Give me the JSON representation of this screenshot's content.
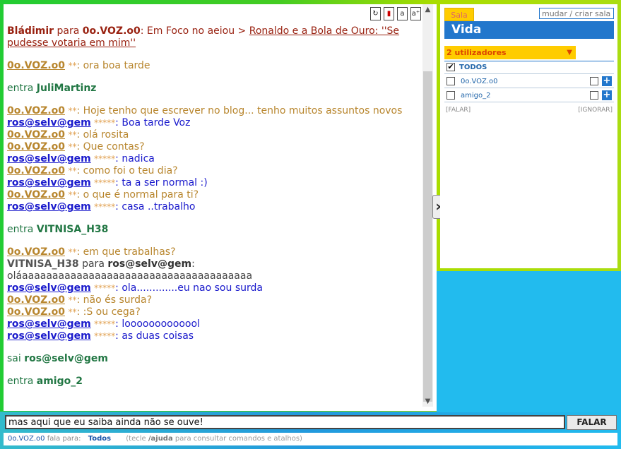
{
  "chat": {
    "messages": [
      {
        "kind": "blad",
        "user": "Blád​imir",
        "para": "para",
        "to": "0o.VOZ.o0",
        "text": ": Em Foco no aeiou > ",
        "link": "Ronaldo e a Bola de Ouro: ''Se pudesse votaria em mim''"
      },
      {
        "kind": "gap"
      },
      {
        "kind": "voz",
        "user": "0o.VOZ.o0",
        "stars": "**",
        "text": ": ora boa tarde"
      },
      {
        "kind": "gap"
      },
      {
        "kind": "entra",
        "action": "entra",
        "user": "JuliMartinz"
      },
      {
        "kind": "gap"
      },
      {
        "kind": "voz",
        "user": "0o.VOZ.o0",
        "stars": "**",
        "text": ": Hoje tenho que escrever no blog... tenho muitos assuntos novos"
      },
      {
        "kind": "ros",
        "user": "ros@selv@gem",
        "stars": "*****",
        "text": ": Boa tarde Voz"
      },
      {
        "kind": "voz",
        "user": "0o.VOZ.o0",
        "stars": "**",
        "text": ": olá rosita"
      },
      {
        "kind": "voz",
        "user": "0o.VOZ.o0",
        "stars": "**",
        "text": ": Que contas?"
      },
      {
        "kind": "ros",
        "user": "ros@selv@gem",
        "stars": "*****",
        "text": ": nadica"
      },
      {
        "kind": "voz",
        "user": "0o.VOZ.o0",
        "stars": "**",
        "text": ": como foi o teu dia?"
      },
      {
        "kind": "ros",
        "user": "ros@selv@gem",
        "stars": "*****",
        "text": ": ta a ser normal :)"
      },
      {
        "kind": "voz",
        "user": "0o.VOZ.o0",
        "stars": "**",
        "text": ": o que é normal para ti?"
      },
      {
        "kind": "ros",
        "user": "ros@selv@gem",
        "stars": "*****",
        "text": ": casa ..trabalho"
      },
      {
        "kind": "gap"
      },
      {
        "kind": "entra",
        "action": "entra",
        "user": "VITNISA_H38"
      },
      {
        "kind": "gap"
      },
      {
        "kind": "voz",
        "user": "0o.VOZ.o0",
        "stars": "**",
        "text": ": em que trabalhas?"
      },
      {
        "kind": "vit",
        "user": "VITNISA_H38",
        "para": "para",
        "to": "ros@selv@gem",
        "text": ": oláaaaaaaaaaaaaaaaaaaaaaaaaaaaaaaaaaaaaaa"
      },
      {
        "kind": "ros",
        "user": "ros@selv@gem",
        "stars": "*****",
        "text": ": ola.............eu nao sou surda"
      },
      {
        "kind": "voz",
        "user": "0o.VOZ.o0",
        "stars": "**",
        "text": ": não és surda?"
      },
      {
        "kind": "voz",
        "user": "0o.VOZ.o0",
        "stars": "**",
        "text": ": :S ou cega?"
      },
      {
        "kind": "ros",
        "user": "ros@selv@gem",
        "stars": "*****",
        "text": ": looooooooooool"
      },
      {
        "kind": "ros",
        "user": "ros@selv@gem",
        "stars": "*****",
        "text": ": as duas coisas"
      },
      {
        "kind": "gap"
      },
      {
        "kind": "entra",
        "action": "sai",
        "user": "ros@selv@gem"
      },
      {
        "kind": "gap"
      },
      {
        "kind": "entra",
        "action": "entra",
        "user": "amigo_2"
      }
    ]
  },
  "side": {
    "room_tab": "Sala",
    "room_input_placeholder": "mudar / criar sala",
    "room_title": "Vida",
    "users_count": "2 utilizadores",
    "todos_label": "TODOS",
    "users": [
      "0o.VOZ.o0",
      "amigo_2"
    ],
    "falar_label": "[FALAR]",
    "ignorar_label": "[IGNORAR]"
  },
  "input": {
    "value": "mas aqui que eu saiba ainda não se ouve!",
    "send_label": "FALAR"
  },
  "status": {
    "user": "0o.VOZ.o0",
    "fala_para": "fala para:",
    "target": "Todos",
    "hint_pre": "(tecle ",
    "hint_cmd": "/ajuda",
    "hint_post": " para consultar comandos e atalhos)"
  }
}
